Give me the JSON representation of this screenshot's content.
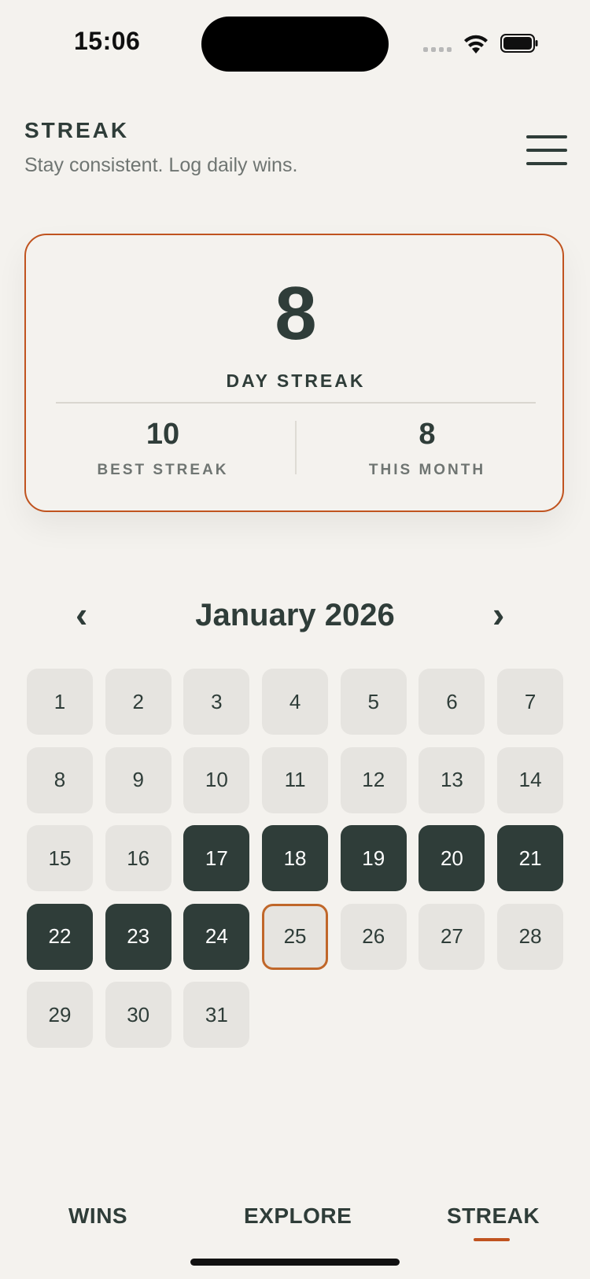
{
  "status": {
    "time": "15:06"
  },
  "header": {
    "title": "STREAK",
    "subtitle": "Stay consistent. Log daily wins."
  },
  "card": {
    "streak": "8",
    "streak_label": "DAY STREAK",
    "best_value": "10",
    "best_label": "BEST STREAK",
    "month_value": "8",
    "month_label": "THIS MONTH"
  },
  "calendar": {
    "prev": "‹",
    "next": "›",
    "month": "January 2026",
    "days": [
      "1",
      "2",
      "3",
      "4",
      "5",
      "6",
      "7",
      "8",
      "9",
      "10",
      "11",
      "12",
      "13",
      "14",
      "15",
      "16",
      "17",
      "18",
      "19",
      "20",
      "21",
      "22",
      "23",
      "24",
      "25",
      "26",
      "27",
      "28",
      "29",
      "30",
      "31"
    ],
    "completed": [
      17,
      18,
      19,
      20,
      21,
      22,
      23,
      24
    ],
    "today": 25
  },
  "tabs": {
    "wins": "WINS",
    "explore": "EXPLORE",
    "streak": "STREAK"
  },
  "colors": {
    "accent": "#c0531f",
    "ink": "#2f3d39",
    "background": "#f4f2ee"
  }
}
